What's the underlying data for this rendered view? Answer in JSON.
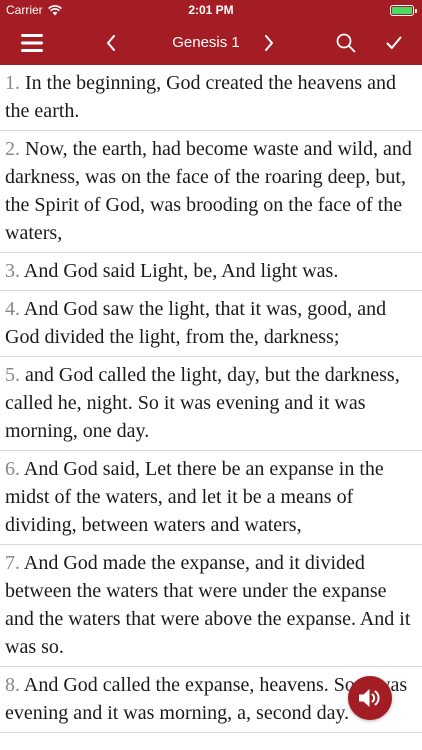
{
  "status_bar": {
    "carrier": "Carrier",
    "time": "2:01 PM",
    "battery_level": 1.0
  },
  "nav": {
    "title": "Genesis 1",
    "icons": [
      "hamburger-menu-icon",
      "chevron-left-icon",
      "chevron-right-icon",
      "search-icon",
      "checkmark-icon"
    ]
  },
  "verses": [
    {
      "num": "1.",
      "text": " In the beginning, God created the heavens and the earth."
    },
    {
      "num": "2.",
      "text": " Now, the earth, had become waste and wild, and darkness, was on the face of the roaring deep, but, the Spirit of God, was brooding on the face of the waters,"
    },
    {
      "num": "3.",
      "text": " And God said Light, be, And light was."
    },
    {
      "num": "4.",
      "text": " And God saw the light, that it was, good, and God divided the light, from the, darkness;"
    },
    {
      "num": "5.",
      "text": " and God called the light, day, but the darkness, called he, night. So it was evening and it was morning, one day."
    },
    {
      "num": "6.",
      "text": " And God said, Let there be an expanse in the midst of the waters, and let it be a means of dividing, between waters and waters,"
    },
    {
      "num": "7.",
      "text": " And God made the expanse, and it divided between the waters that were under the expanse and the waters that were above the expanse. And it was so."
    },
    {
      "num": "8.",
      "text": " And God called the expanse, heavens. So it was evening and it was morning, a, second day."
    }
  ],
  "colors": {
    "brand": "#a51d24",
    "verse_number": "#888888",
    "battery": "#4cd964"
  }
}
